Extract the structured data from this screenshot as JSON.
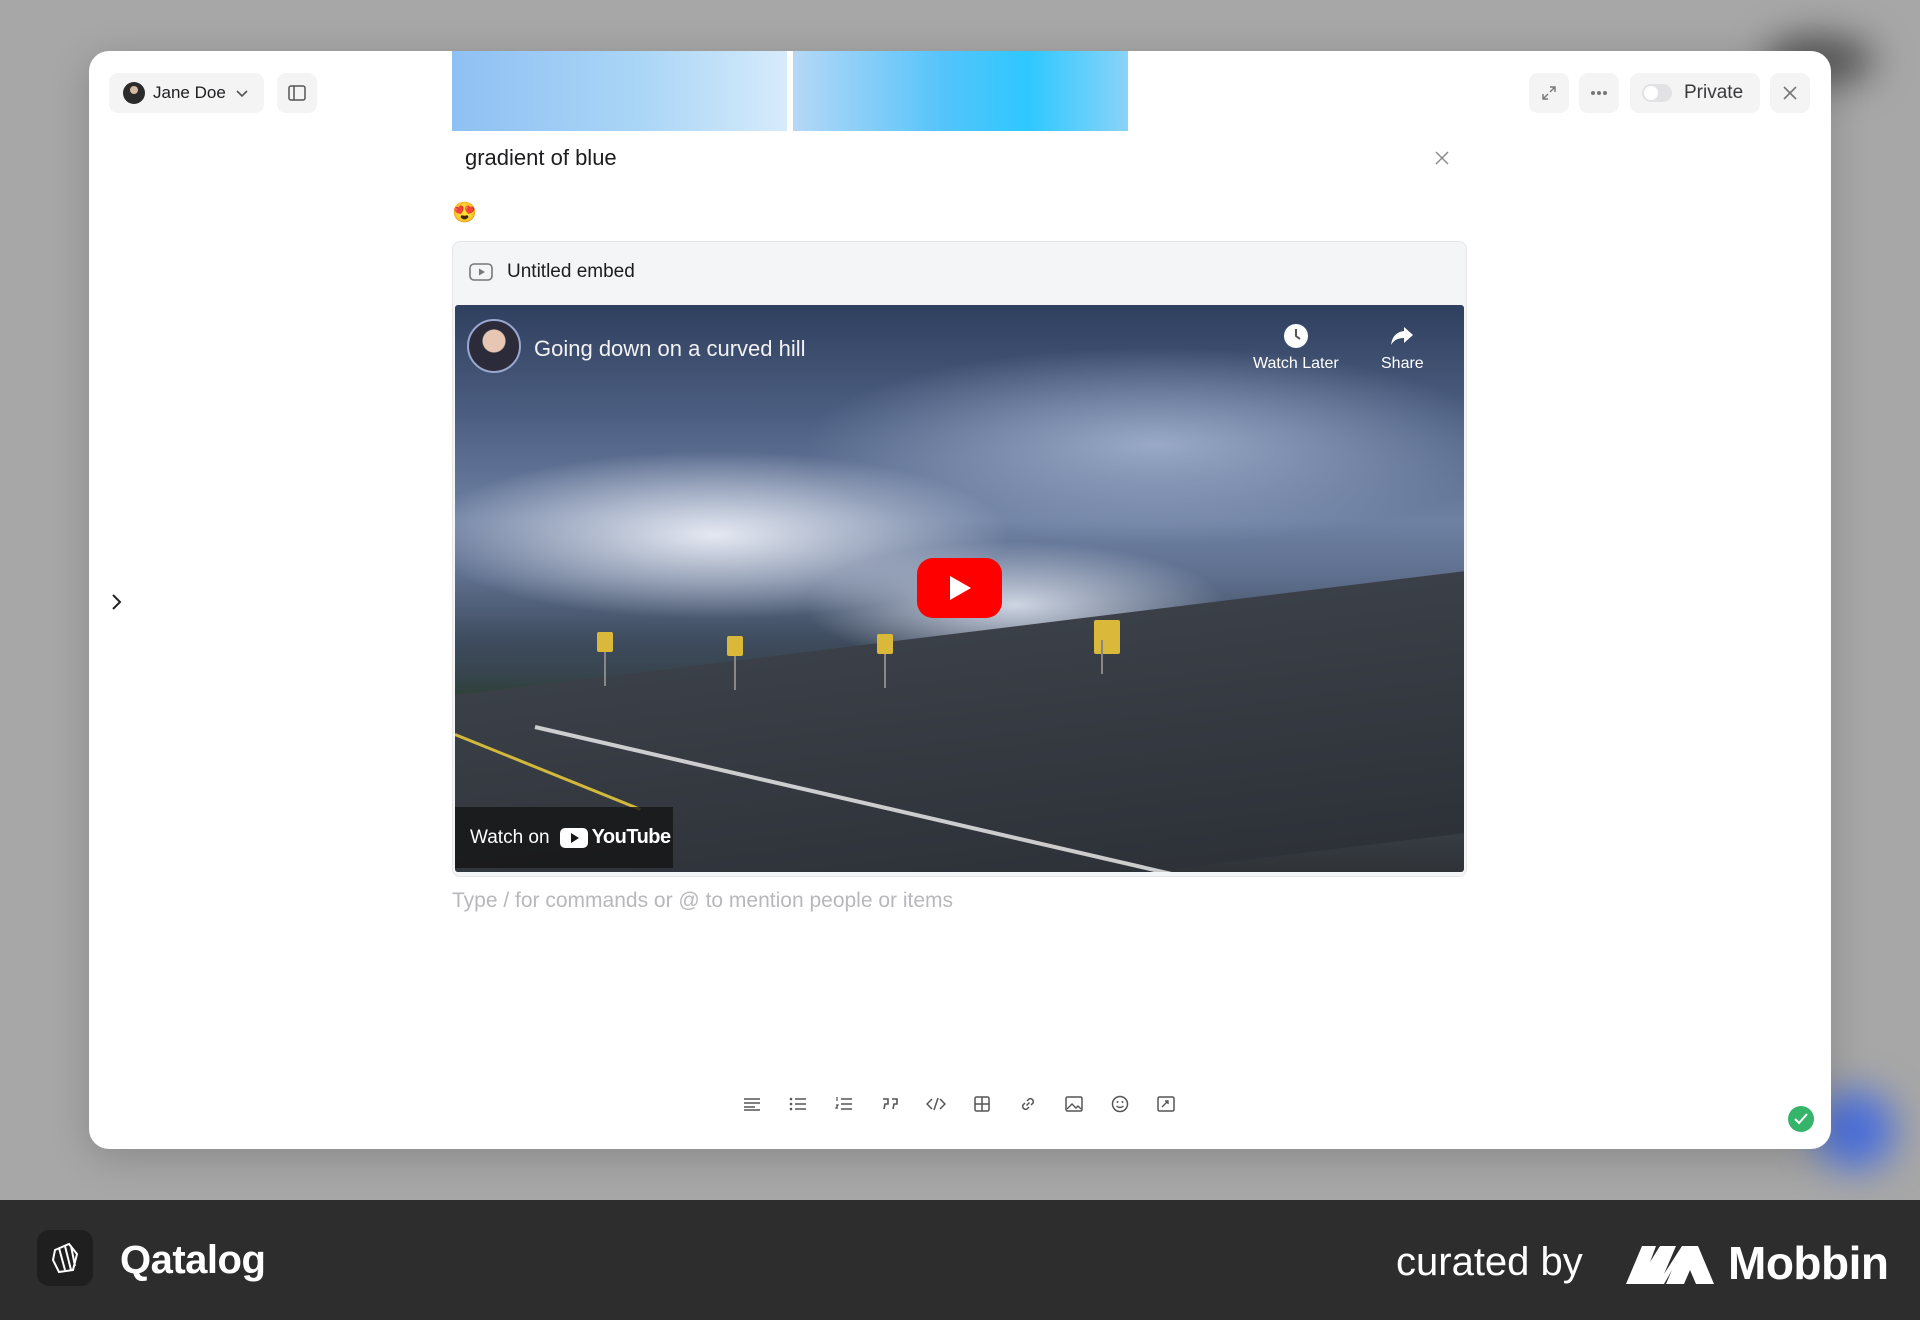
{
  "app": {
    "name": "Qatalog"
  },
  "header": {
    "user_name": "Jane Doe",
    "privacy_label": "Private"
  },
  "cover": {
    "caption": "gradient of blue"
  },
  "content": {
    "emoji": "😍",
    "embed_title": "Untitled embed",
    "placeholder": "Type / for commands or @ to mention people or items"
  },
  "video": {
    "title": "Going down on a curved hill",
    "watch_later_label": "Watch Later",
    "share_label": "Share",
    "watch_on_label": "Watch on",
    "platform": "YouTube"
  },
  "toolbar": {
    "tools": [
      "align-text-icon",
      "bullet-list-icon",
      "numbered-list-icon",
      "quote-icon",
      "code-icon",
      "table-icon",
      "link-icon",
      "image-icon",
      "emoji-icon",
      "embed-icon"
    ]
  },
  "footer": {
    "brand": "Qatalog",
    "curated_by": "curated by",
    "curator": "Mobbin"
  },
  "colors": {
    "status_saved": "#34b56a",
    "youtube_red": "#ff0000",
    "footer_bg": "#2d2d2d"
  }
}
